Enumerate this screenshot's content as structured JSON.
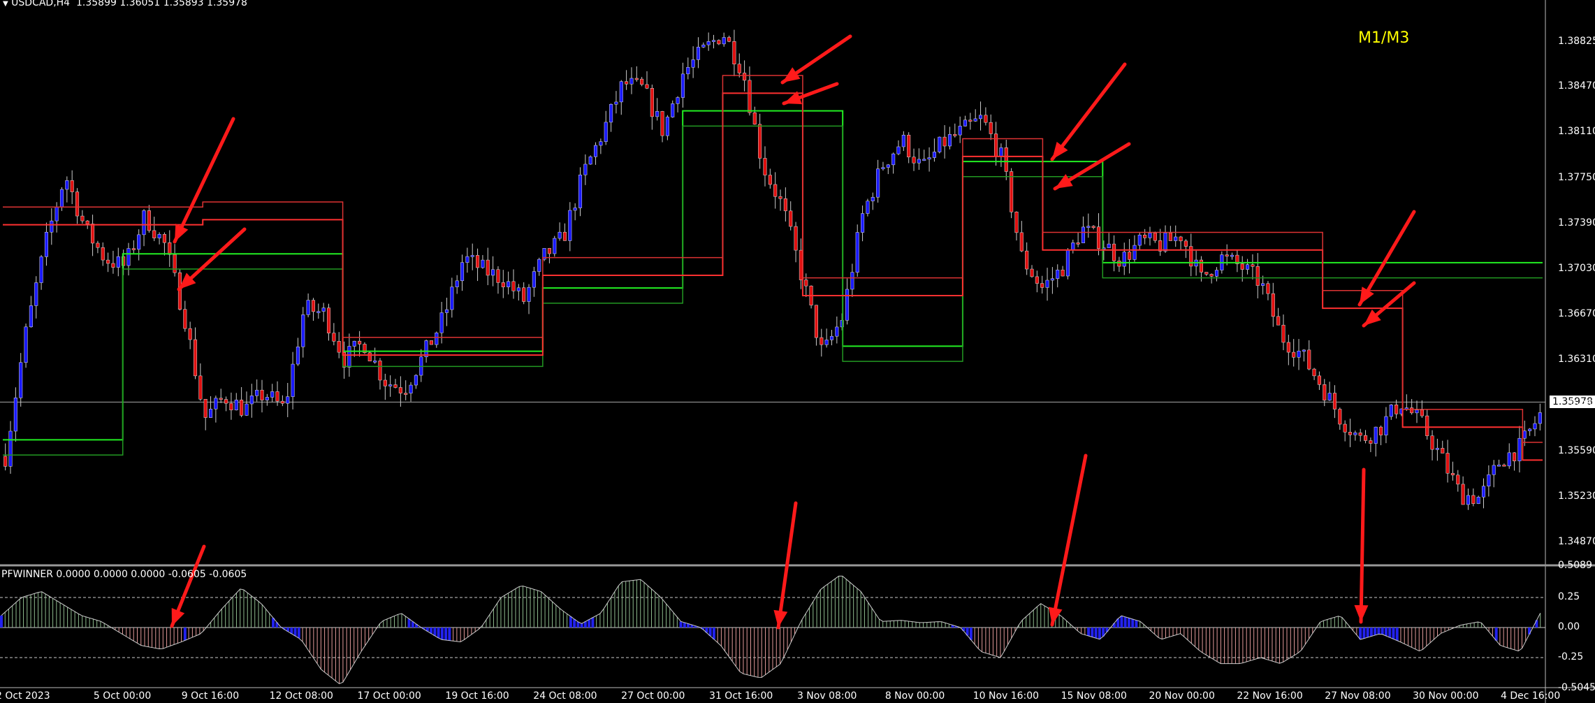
{
  "header": {
    "symbol": "USDCAD,H4",
    "ohlc": "1.35899 1.36051 1.35893 1.35978"
  },
  "annotation": "M1/M3",
  "indicator": {
    "label": "PFWINNER 0.0000 0.0000 0.0000 -0.0605 -0.0605"
  },
  "price_axis": [
    "1.38825",
    "1.38470",
    "1.38110",
    "1.37750",
    "1.37390",
    "1.37030",
    "1.36670",
    "1.36310",
    "1.35950",
    "1.35590",
    "1.35230",
    "1.34870"
  ],
  "current_price": "1.35978",
  "indicator_axis": [
    "0.5089",
    "0.25",
    "0.00",
    "-0.25",
    "-0.5045"
  ],
  "time_axis": [
    "2 Oct 2023",
    "5 Oct 00:00",
    "9 Oct 16:00",
    "12 Oct 08:00",
    "17 Oct 00:00",
    "19 Oct 16:00",
    "24 Oct 08:00",
    "27 Oct 00:00",
    "31 Oct 16:00",
    "3 Nov 08:00",
    "8 Nov 00:00",
    "10 Nov 16:00",
    "15 Nov 08:00",
    "20 Nov 00:00",
    "22 Nov 16:00",
    "27 Nov 08:00",
    "30 Nov 00:00",
    "4 Dec 16:00"
  ],
  "colors": {
    "background": "#000000",
    "bull_candle": "#1a1aff",
    "bear_candle": "#e01010",
    "support_line": "#22ee22",
    "resistance_line": "#ff3030",
    "arrow": "#ff1a1a",
    "annotation": "#ffff00"
  },
  "chart_data": {
    "type": "candlestick",
    "timeframe": "H4",
    "price_range": [
      1.3458,
      1.3905
    ],
    "indicator_range": [
      -0.5045,
      0.5089
    ],
    "price_path": [
      1.3555,
      1.365,
      1.3722,
      1.3778,
      1.3735,
      1.3711,
      1.3705,
      1.3745,
      1.3722,
      1.3665,
      1.3585,
      1.3602,
      1.3592,
      1.3605,
      1.3592,
      1.3672,
      1.3668,
      1.3632,
      1.3645,
      1.3615,
      1.3608,
      1.3635,
      1.3665,
      1.3712,
      1.3702,
      1.3695,
      1.3678,
      1.3712,
      1.3728,
      1.3778,
      1.3812,
      1.385,
      1.3845,
      1.3812,
      1.3858,
      1.3875,
      1.389,
      1.386,
      1.3785,
      1.3752,
      1.3695,
      1.3635,
      1.3665,
      1.3745,
      1.3785,
      1.3805,
      1.3782,
      1.3802,
      1.3812,
      1.3822,
      1.379,
      1.3712,
      1.3688,
      1.3703,
      1.3735,
      1.3725,
      1.371,
      1.3725,
      1.3722,
      1.373,
      1.3695,
      1.3712,
      1.3705,
      1.3692,
      1.365,
      1.3636,
      1.3612,
      1.3585,
      1.3568,
      1.3578,
      1.3598,
      1.3582,
      1.3555,
      1.3525,
      1.3522,
      1.3552,
      1.3562,
      1.3588
    ],
    "support_steps": [
      [
        0,
        1.3568
      ],
      [
        6,
        1.3715
      ],
      [
        17,
        1.3638
      ],
      [
        27,
        1.3688
      ],
      [
        34,
        1.3828
      ],
      [
        42,
        1.3642
      ],
      [
        48,
        1.3788
      ],
      [
        55,
        1.3708
      ],
      [
        62,
        1.3708
      ]
    ],
    "resistance_steps": [
      [
        0,
        1.3738
      ],
      [
        10,
        1.3742
      ],
      [
        17,
        1.3635
      ],
      [
        27,
        1.3698
      ],
      [
        36,
        1.3842
      ],
      [
        40,
        1.3682
      ],
      [
        48,
        1.3792
      ],
      [
        52,
        1.3718
      ],
      [
        62,
        1.3718
      ],
      [
        66,
        1.3672
      ],
      [
        70,
        1.3578
      ],
      [
        76,
        1.3552
      ]
    ],
    "oscillator": [
      0.1,
      0.25,
      0.3,
      0.2,
      0.1,
      0.05,
      -0.05,
      -0.15,
      -0.18,
      -0.12,
      -0.05,
      0.15,
      0.33,
      0.2,
      0.0,
      -0.1,
      -0.35,
      -0.48,
      -0.2,
      0.05,
      0.12,
      0.0,
      -0.1,
      -0.12,
      0.0,
      0.25,
      0.35,
      0.3,
      0.15,
      0.03,
      0.12,
      0.38,
      0.4,
      0.25,
      0.05,
      0.0,
      -0.15,
      -0.38,
      -0.42,
      -0.3,
      0.05,
      0.32,
      0.44,
      0.3,
      0.05,
      0.06,
      0.04,
      0.05,
      0.0,
      -0.2,
      -0.25,
      0.05,
      0.2,
      0.1,
      -0.05,
      -0.1,
      0.1,
      0.05,
      -0.1,
      -0.05,
      -0.2,
      -0.3,
      -0.3,
      -0.25,
      -0.3,
      -0.2,
      0.05,
      0.1,
      -0.1,
      -0.05,
      -0.12,
      -0.2,
      -0.05,
      0.02,
      0.05,
      -0.15,
      -0.2,
      0.12
    ],
    "annotations": [
      "M1/M3"
    ]
  }
}
